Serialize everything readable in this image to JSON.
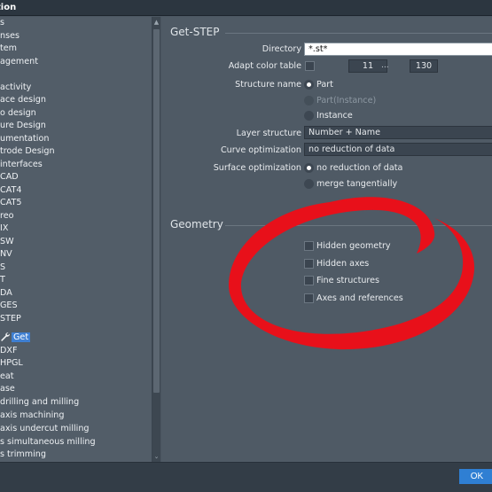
{
  "window": {
    "title": "tion"
  },
  "tree": {
    "items": [
      {
        "label": "s"
      },
      {
        "label": "nses"
      },
      {
        "label": "tem"
      },
      {
        "label": "agement"
      },
      {
        "label": ""
      },
      {
        "label": "activity"
      },
      {
        "label": "ace design"
      },
      {
        "label": "o design"
      },
      {
        "label": "ure Design"
      },
      {
        "label": "umentation"
      },
      {
        "label": "trode Design"
      },
      {
        "label": "interfaces"
      },
      {
        "label": "CAD"
      },
      {
        "label": "CAT4"
      },
      {
        "label": "CAT5"
      },
      {
        "label": "reo"
      },
      {
        "label": "IX"
      },
      {
        "label": "SW"
      },
      {
        "label": "NV"
      },
      {
        "label": "S"
      },
      {
        "label": "T"
      },
      {
        "label": "DA"
      },
      {
        "label": "GES"
      },
      {
        "label": "STEP"
      },
      {
        "label": "Get",
        "selected": true
      },
      {
        "label": "DXF"
      },
      {
        "label": "HPGL"
      },
      {
        "label": "eat"
      },
      {
        "label": "ase"
      },
      {
        "label": "drilling and milling"
      },
      {
        "label": "axis machining"
      },
      {
        "label": "axis undercut milling"
      },
      {
        "label": "s simultaneous milling"
      },
      {
        "label": "s trimming"
      }
    ]
  },
  "get_step": {
    "title": "Get-STEP",
    "directory": {
      "label": "Directory",
      "value": "*.st*"
    },
    "adapt_color": {
      "label": "Adapt color table",
      "min": "11",
      "sep": "...",
      "max": "130"
    },
    "structure_name": {
      "label": "Structure name",
      "options": [
        {
          "label": "Part",
          "selected": true,
          "enabled": true
        },
        {
          "label": "Part(Instance)",
          "selected": false,
          "enabled": false
        },
        {
          "label": "Instance",
          "selected": false,
          "enabled": true
        }
      ]
    },
    "layer_structure": {
      "label": "Layer structure",
      "value": "Number + Name"
    },
    "curve_optimization": {
      "label": "Curve optimization",
      "value": "no reduction of data"
    },
    "surface_optimization": {
      "label": "Surface optimization",
      "options": [
        {
          "label": "no reduction of data",
          "selected": true
        },
        {
          "label": "merge tangentially",
          "selected": false
        }
      ]
    }
  },
  "geometry": {
    "title": "Geometry",
    "checks": [
      {
        "label": "Hidden geometry"
      },
      {
        "label": "Hidden axes"
      },
      {
        "label": "Fine structures"
      },
      {
        "label": "Axes and references"
      }
    ]
  },
  "footer": {
    "ok_label": "OK"
  },
  "colors": {
    "accent": "#3f7fd1",
    "annotation": "#e8101a"
  }
}
